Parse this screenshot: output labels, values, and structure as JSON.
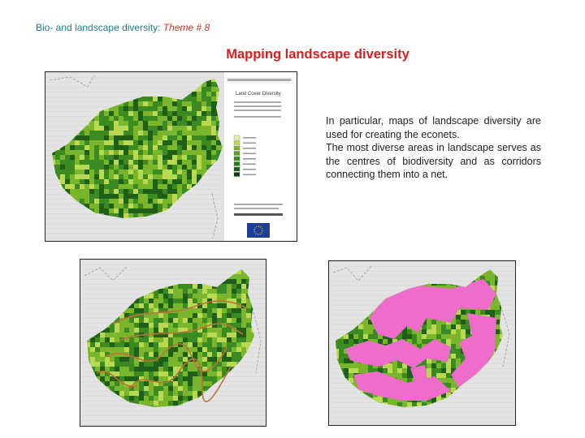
{
  "header": {
    "prefix": "Bio-  and landscape diversity:",
    "theme": "Theme # 8"
  },
  "title": "Mapping landscape diversity",
  "body_paragraphs": [
    "In particular, maps of landscape diversity are used for creating the econets.",
    "The most diverse areas in landscape serves as the centres of biodiversity and as corridors connecting them into a net."
  ],
  "maps": {
    "land_cover": {
      "legend_title": "Land Cover Diversity"
    },
    "colors": {
      "background_grid": "#e3e3e3",
      "green_dark": "#1f5f18",
      "green_mid": "#3b8a22",
      "green_light": "#7ab62c",
      "green_pale": "#b9d952",
      "corridor_line": "#c0703a",
      "econet_pink": "#f06ccb"
    }
  }
}
